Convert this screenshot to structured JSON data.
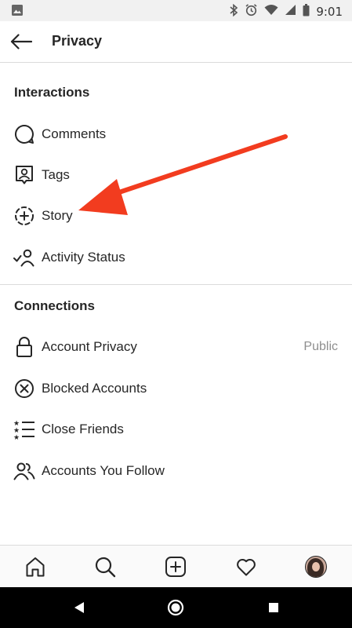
{
  "status_bar": {
    "time": "9:01"
  },
  "header": {
    "title": "Privacy"
  },
  "sections": [
    {
      "title": "Interactions",
      "items": [
        {
          "label": "Comments",
          "icon": "comment-bubble-icon"
        },
        {
          "label": "Tags",
          "icon": "tag-person-icon"
        },
        {
          "label": "Story",
          "icon": "story-plus-icon"
        },
        {
          "label": "Activity Status",
          "icon": "activity-status-icon"
        }
      ]
    },
    {
      "title": "Connections",
      "items": [
        {
          "label": "Account Privacy",
          "value": "Public",
          "icon": "lock-icon"
        },
        {
          "label": "Blocked Accounts",
          "icon": "blocked-x-icon"
        },
        {
          "label": "Close Friends",
          "icon": "close-friends-list-icon"
        },
        {
          "label": "Accounts You Follow",
          "icon": "people-icon"
        }
      ]
    }
  ],
  "tab_bar": [
    "home-icon",
    "search-icon",
    "new-post-icon",
    "heart-icon",
    "profile-avatar"
  ],
  "annotation": {
    "arrow_color": "#f23c1f",
    "points_to": "Story"
  },
  "colors": {
    "text": "#262626",
    "secondary": "#8e8e8e",
    "divider": "#dbdbdb",
    "status_bg": "#f1f1f1"
  }
}
